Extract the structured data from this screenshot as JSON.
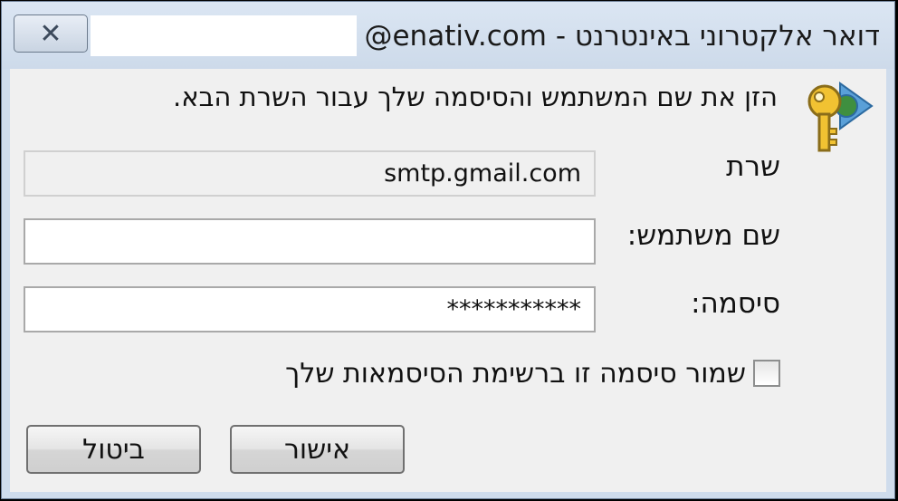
{
  "window": {
    "title": "@enativ.com - דואר אלקטרוני באינטרנט",
    "close_icon": "close-icon"
  },
  "dialog": {
    "prompt": "הזן את שם המשתמש והסיסמה שלך עבור השרת הבא.",
    "icon": "key-globe-icon",
    "server_label": "שרת",
    "server_value": "smtp.gmail.com",
    "username_label": "שם משתמש:",
    "username_value": "",
    "password_label": "סיסמה:",
    "password_value": "***********",
    "remember_label": "שמור סיסמה זו ברשימת הסיסמאות שלך",
    "remember_checked": false,
    "ok_label": "אישור",
    "cancel_label": "ביטול"
  }
}
